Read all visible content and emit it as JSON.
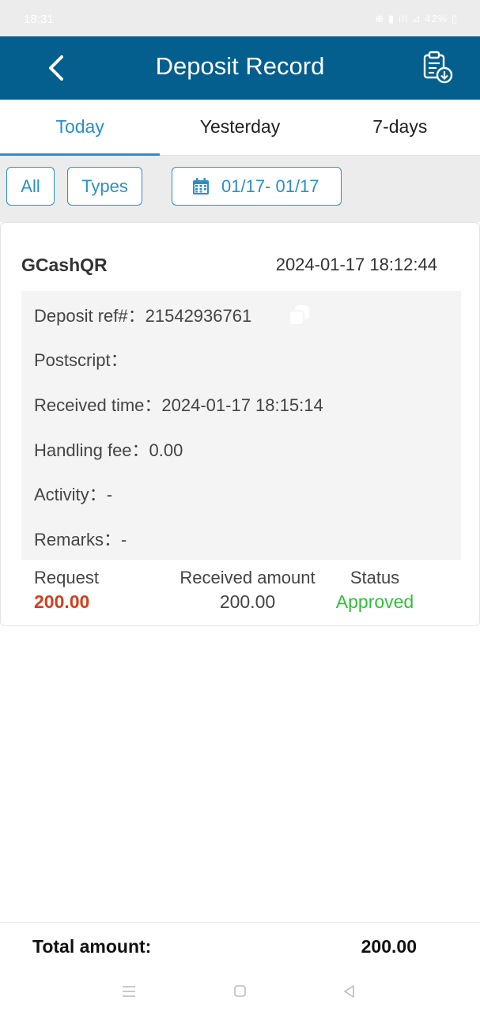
{
  "status_bar": {
    "time": "18:31",
    "icons": "⊕ ▮ ıll ⊿ 42% ▯"
  },
  "header": {
    "title": "Deposit Record",
    "back_icon": "chevron-left-icon",
    "export_icon": "clipboard-download-icon"
  },
  "tabs": [
    {
      "label": "Today",
      "active": true
    },
    {
      "label": "Yesterday",
      "active": false
    },
    {
      "label": "7-days",
      "active": false
    }
  ],
  "filters": {
    "all": "All",
    "types": "Types",
    "date_range": "01/17- 01/17"
  },
  "record": {
    "method": "GCashQR",
    "time": "2024-01-17 18:12:44",
    "details": [
      {
        "label": "Deposit ref#：",
        "value": "21542936761"
      },
      {
        "label": "Postscript：",
        "value": ""
      },
      {
        "label": "Received time：",
        "value": "2024-01-17 18:15:14"
      },
      {
        "label": "Handling fee：",
        "value": "0.00"
      },
      {
        "label": "Activity：",
        "value": "-"
      },
      {
        "label": "Remarks：",
        "value": "-"
      }
    ],
    "request_label": "Request",
    "request_value": "200.00",
    "received_label": "Received amount",
    "received_value": "200.00",
    "status_label": "Status",
    "status_value": "Approved"
  },
  "total": {
    "label": "Total amount:",
    "value": "200.00"
  },
  "colors": {
    "header": "#045f8e",
    "accent": "#2a8fc9",
    "request": "#d63d1e",
    "approved": "#2fbf3a"
  }
}
